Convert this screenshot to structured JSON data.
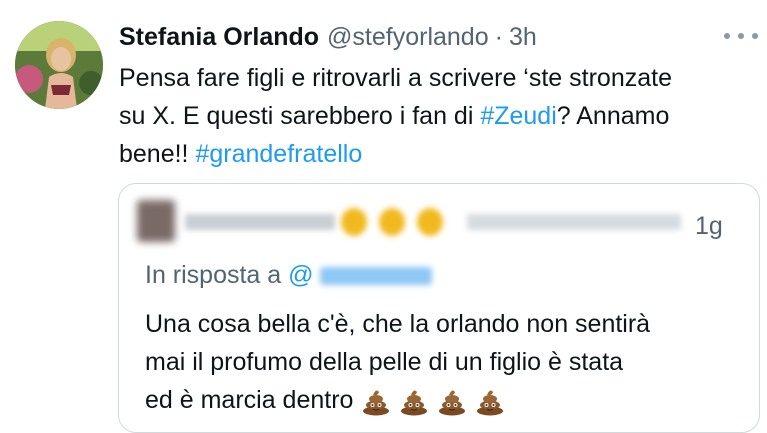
{
  "tweet": {
    "author_name": "Stefania Orlando",
    "handle": "@stefyorlando",
    "separator": "·",
    "age": "3h",
    "text_lines": [
      {
        "pre": "Pensa fare figli e ritrovarli a scrivere ‘ste stronzate",
        "tag": "",
        "post": ""
      },
      {
        "pre": "su X. E questi sarebbero i fan di ",
        "tag": "#Zeudi",
        "post": "? Annamo"
      },
      {
        "pre": "bene!! ",
        "tag": "#grandefratello",
        "post": ""
      }
    ]
  },
  "quote": {
    "age": "1g",
    "reply_prefix": "In risposta a ",
    "reply_at": "@",
    "text_lines": [
      "Una cosa bella c'è, che la orlando non sentirà",
      "mai il profumo della pelle di un figlio è stata",
      "ed è marcia dentro"
    ],
    "poop_emoji_count": 4
  },
  "colors": {
    "link": "#1d9bf0",
    "secondary_text": "#536471",
    "border": "#cfd9de"
  },
  "icons": {
    "more": "more-dots-icon",
    "poop": "poop-emoji-icon"
  }
}
